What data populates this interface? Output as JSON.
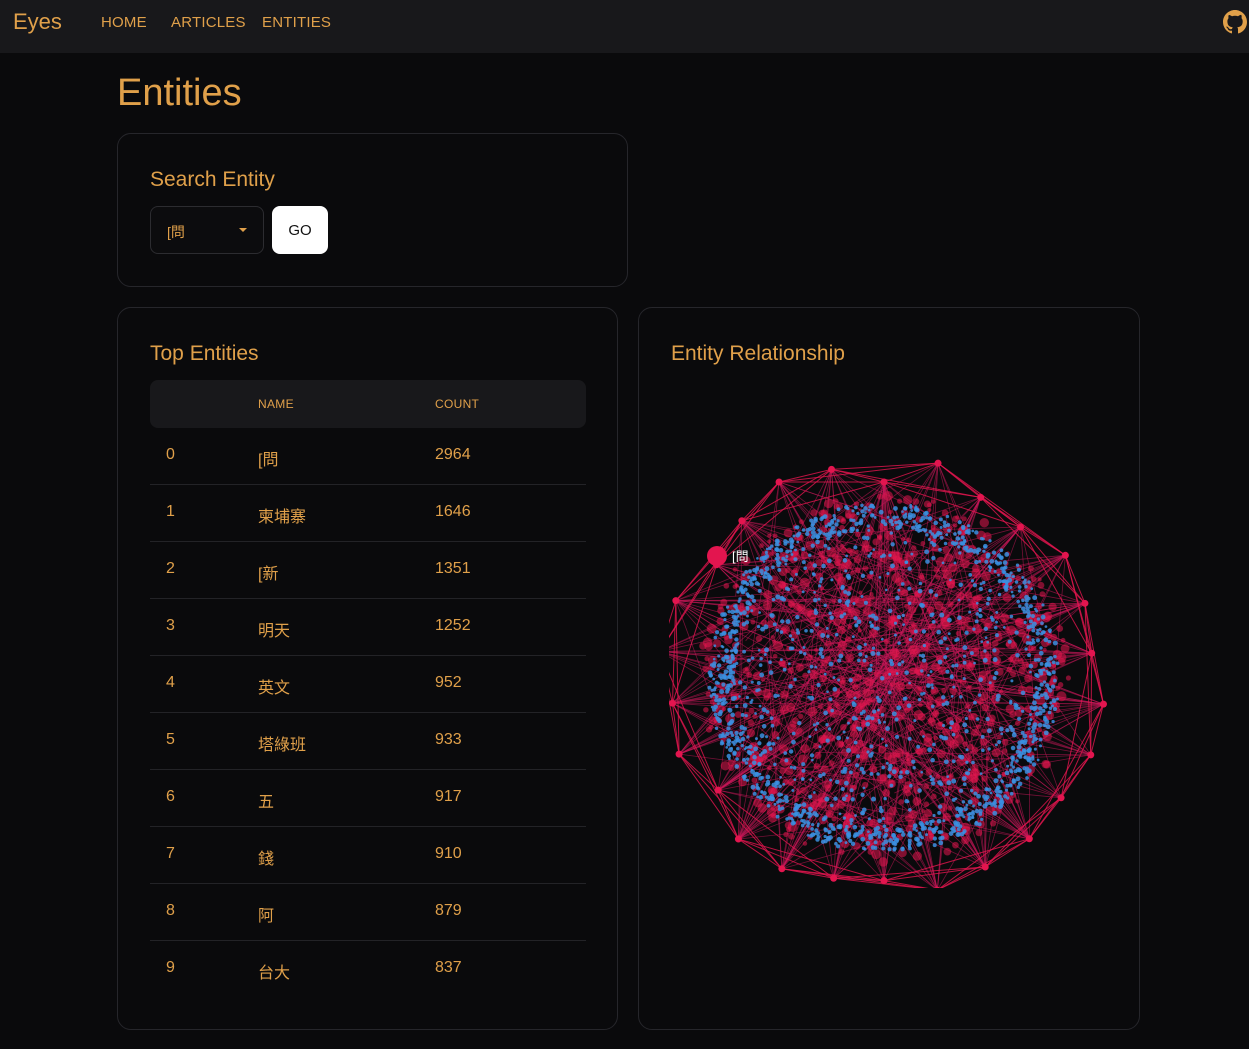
{
  "nav": {
    "brand": "Eyes",
    "links": [
      "HOME",
      "ARTICLES",
      "ENTITIES"
    ]
  },
  "page": {
    "title": "Entities"
  },
  "search": {
    "title": "Search Entity",
    "selected": "[問",
    "go_label": "GO"
  },
  "top_entities": {
    "title": "Top Entities",
    "headers": [
      "",
      "NAME",
      "COUNT"
    ],
    "rows": [
      {
        "idx": "0",
        "name": "[問",
        "count": "2964"
      },
      {
        "idx": "1",
        "name": "柬埔寨",
        "count": "1646"
      },
      {
        "idx": "2",
        "name": "[新",
        "count": "1351"
      },
      {
        "idx": "3",
        "name": "明天",
        "count": "1252"
      },
      {
        "idx": "4",
        "name": "英文",
        "count": "952"
      },
      {
        "idx": "5",
        "name": "塔綠班",
        "count": "933"
      },
      {
        "idx": "6",
        "name": "五",
        "count": "917"
      },
      {
        "idx": "7",
        "name": "錢",
        "count": "910"
      },
      {
        "idx": "8",
        "name": "阿",
        "count": "879"
      },
      {
        "idx": "9",
        "name": "台大",
        "count": "837"
      }
    ]
  },
  "relationship": {
    "title": "Entity Relationship",
    "highlight_label": "[問",
    "colors": {
      "node_primary": "#e3154f",
      "node_secondary": "#3b8fe0",
      "edge": "#c8185a"
    }
  },
  "colors": {
    "accent": "#e0a04a",
    "background": "#0a0a0c",
    "panel": "#18181b"
  }
}
